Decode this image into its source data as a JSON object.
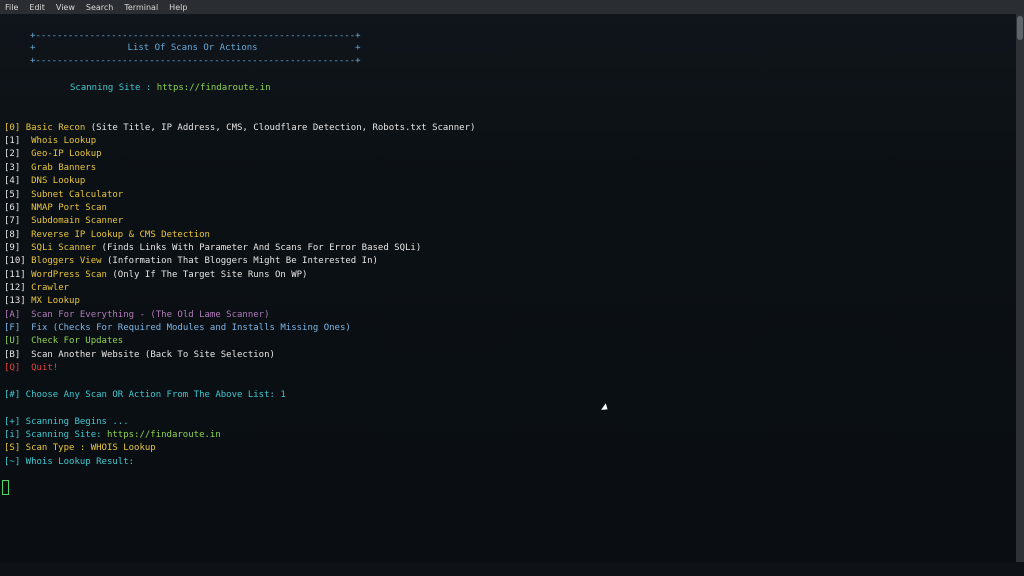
{
  "menubar": {
    "items": [
      "File",
      "Edit",
      "View",
      "Search",
      "Terminal",
      "Help"
    ]
  },
  "terminal": {
    "border_line": "+-----------------------------------------------------------+",
    "header_title": "+                 List Of Scans Or Actions                  +",
    "scanning_site_label": "Scanning Site : ",
    "scanning_site_url": "https://findaroute.in",
    "menu": [
      {
        "key": "[0]",
        "label": "Basic Recon",
        "detail": " (Site Title, IP Address, CMS, Cloudflare Detection, Robots.txt Scanner)"
      },
      {
        "key": "[1]",
        "label": "Whois Lookup",
        "detail": ""
      },
      {
        "key": "[2]",
        "label": "Geo-IP Lookup",
        "detail": ""
      },
      {
        "key": "[3]",
        "label": "Grab Banners",
        "detail": ""
      },
      {
        "key": "[4]",
        "label": "DNS Lookup",
        "detail": ""
      },
      {
        "key": "[5]",
        "label": "Subnet Calculator",
        "detail": ""
      },
      {
        "key": "[6]",
        "label": "NMAP Port Scan",
        "detail": ""
      },
      {
        "key": "[7]",
        "label": "Subdomain Scanner",
        "detail": ""
      },
      {
        "key": "[8]",
        "label": "Reverse IP Lookup & CMS Detection",
        "detail": ""
      },
      {
        "key": "[9]",
        "label": "SQLi Scanner",
        "detail": " (Finds Links With Parameter And Scans For Error Based SQLi)"
      },
      {
        "key": "[10]",
        "label": "Bloggers View",
        "detail": " (Information That Bloggers Might Be Interested In)"
      },
      {
        "key": "[11]",
        "label": "WordPress Scan",
        "detail": " (Only If The Target Site Runs On WP)"
      },
      {
        "key": "[12]",
        "label": "Crawler",
        "detail": ""
      },
      {
        "key": "[13]",
        "label": "MX Lookup",
        "detail": ""
      }
    ],
    "extra": {
      "a_key": "[A]",
      "a_label": "Scan For Everything - (The Old Lame Scanner)",
      "f_key": "[F]",
      "f_label": "Fix (Checks For Required Modules and Installs Missing Ones)",
      "u_key": "[U]",
      "u_label": "Check For Updates",
      "b_key": "[B]",
      "b_label": "Scan Another Website (Back To Site Selection)",
      "q_key": "[Q]",
      "q_label": "Quit!"
    },
    "prompt": "[#] Choose Any Scan OR Action From The Above List: 1",
    "scan_begins": "[+] Scanning Begins ...",
    "scan_site_prefix": "[i] Scanning Site: ",
    "scan_site_url": "https://findaroute.in",
    "scan_type_prefix": "[S] Scan Type : ",
    "scan_type": "WHOIS Lookup",
    "result": "[~] Whois Lookup Result:"
  }
}
